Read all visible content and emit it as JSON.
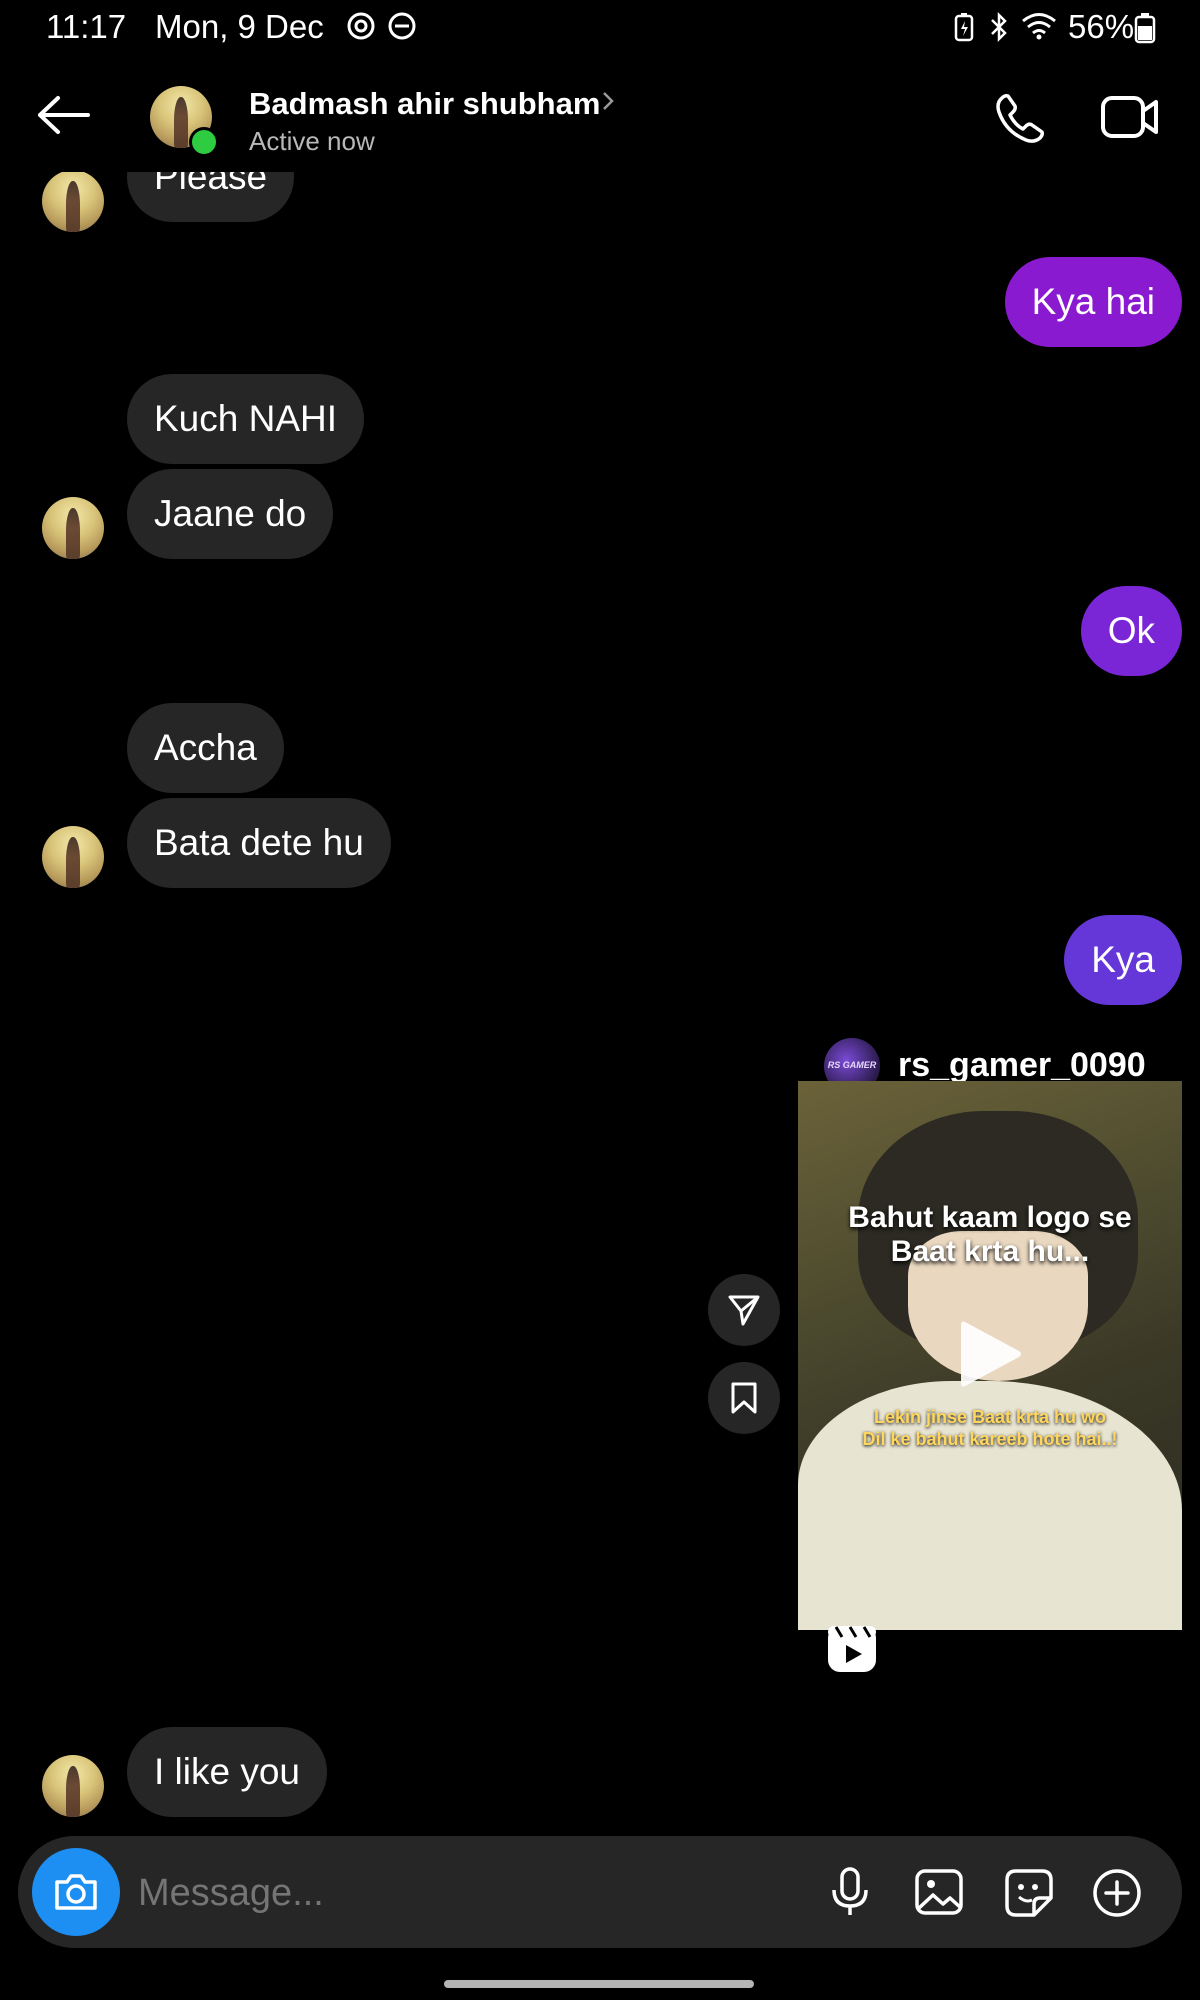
{
  "status_bar": {
    "time": "11:17",
    "date": "Mon, 9 Dec",
    "battery": "56%"
  },
  "header": {
    "contact_name": "Badmash ahir shubham",
    "presence": "Active now",
    "online_color": "#2ecc40"
  },
  "messages": [
    {
      "side": "received",
      "text": "Please"
    },
    {
      "side": "sent",
      "text": "Kya hai",
      "color": "#8a1ad0"
    },
    {
      "side": "received",
      "text": "Kuch NAHI"
    },
    {
      "side": "received",
      "text": "Jaane do"
    },
    {
      "side": "sent",
      "text": "Ok",
      "color": "#7a26d6"
    },
    {
      "side": "received",
      "text": "Accha"
    },
    {
      "side": "received",
      "text": "Bata dete hu"
    },
    {
      "side": "sent",
      "text": "Kya",
      "color": "#6537d8"
    },
    {
      "side": "received",
      "text": "I like you"
    }
  ],
  "shared_reel": {
    "username": "rs_gamer_0090",
    "caption_top": "Bahut kaam logo se\nBaat krta hu...",
    "caption_bottom": "Lekin jinse Baat krta hu wo\nDil ke bahut kareeb hote hai..!",
    "avatar_text": "RS GAMER"
  },
  "composer": {
    "placeholder": "Message...",
    "camera_color": "#1d8ff2"
  },
  "icons": [
    "back-arrow-icon",
    "phone-icon",
    "video-call-icon",
    "send-icon",
    "bookmark-icon",
    "play-icon",
    "reels-icon",
    "camera-icon",
    "microphone-icon",
    "gallery-icon",
    "sticker-icon",
    "plus-icon",
    "dnd-icon",
    "threads-icon",
    "wifi-icon",
    "bluetooth-icon",
    "battery-icon"
  ]
}
